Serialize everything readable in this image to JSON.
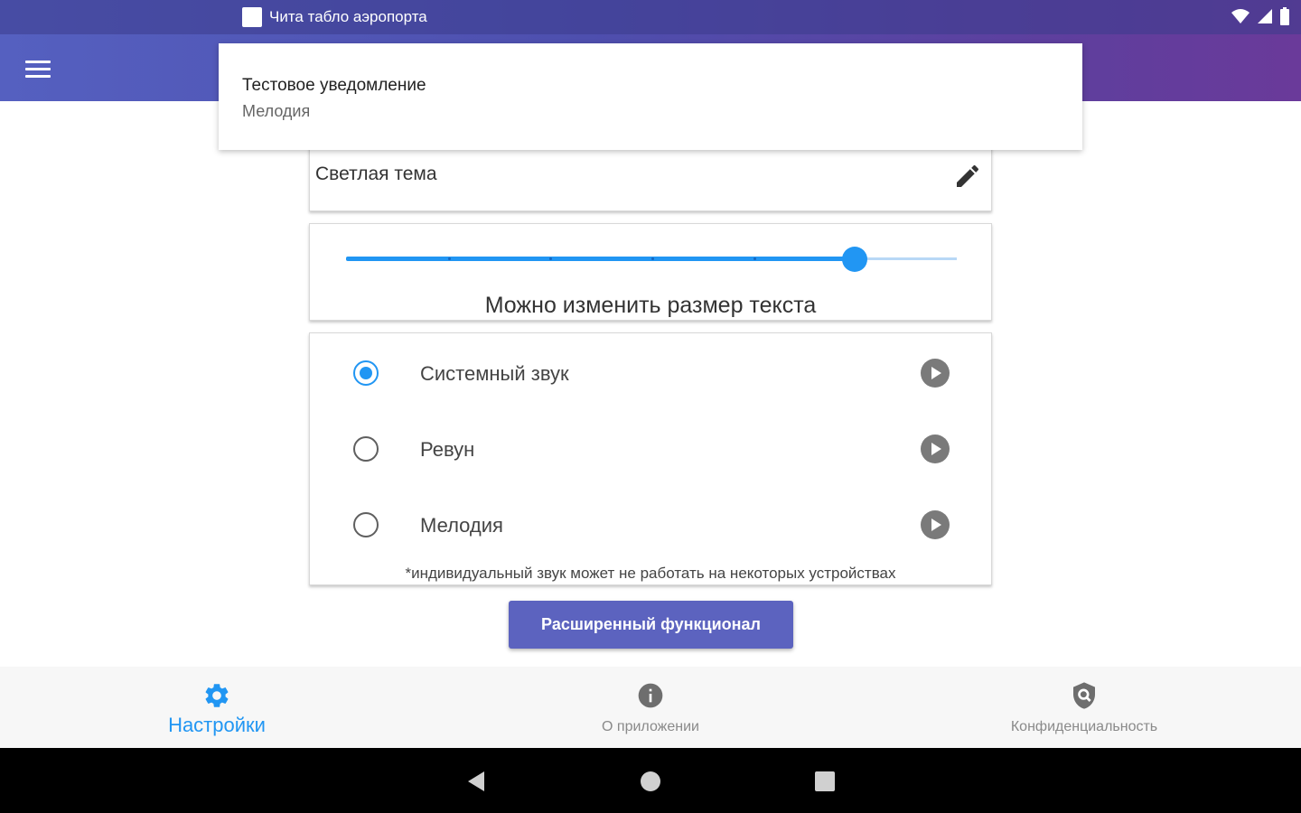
{
  "status_bar": {
    "notification_title": "Чита табло аэропорта",
    "icons": [
      "wifi-icon",
      "cellular-icon",
      "battery-icon"
    ]
  },
  "app_bar": {
    "menu_icon": "hamburger-menu-icon"
  },
  "notification": {
    "title": "Тестовое уведомление",
    "text": "Мелодия"
  },
  "theme": {
    "value": "Светлая тема",
    "edit_icon": "pencil-icon"
  },
  "text_size": {
    "caption": "Можно изменить размер текста",
    "slider_value": 5,
    "slider_min": 0,
    "slider_max": 6,
    "accent_color": "#2196f3"
  },
  "sounds": {
    "options": [
      {
        "label": "Системный звук",
        "selected": true
      },
      {
        "label": "Ревун",
        "selected": false
      },
      {
        "label": "Мелодия",
        "selected": false
      }
    ],
    "note": "*индивидуальный звук может не работать на некоторых устройствах"
  },
  "extended_button": {
    "label": "Расширенный функционал",
    "color": "#5c63bf"
  },
  "bottom_nav": {
    "items": [
      {
        "label": "Настройки",
        "icon": "gear-icon",
        "active": true
      },
      {
        "label": "О приложении",
        "icon": "info-icon",
        "active": false
      },
      {
        "label": "Конфиденциальность",
        "icon": "privacy-shield-icon",
        "active": false
      }
    ]
  },
  "system_nav": {
    "icons": [
      "back-icon",
      "home-icon",
      "recents-icon"
    ]
  }
}
